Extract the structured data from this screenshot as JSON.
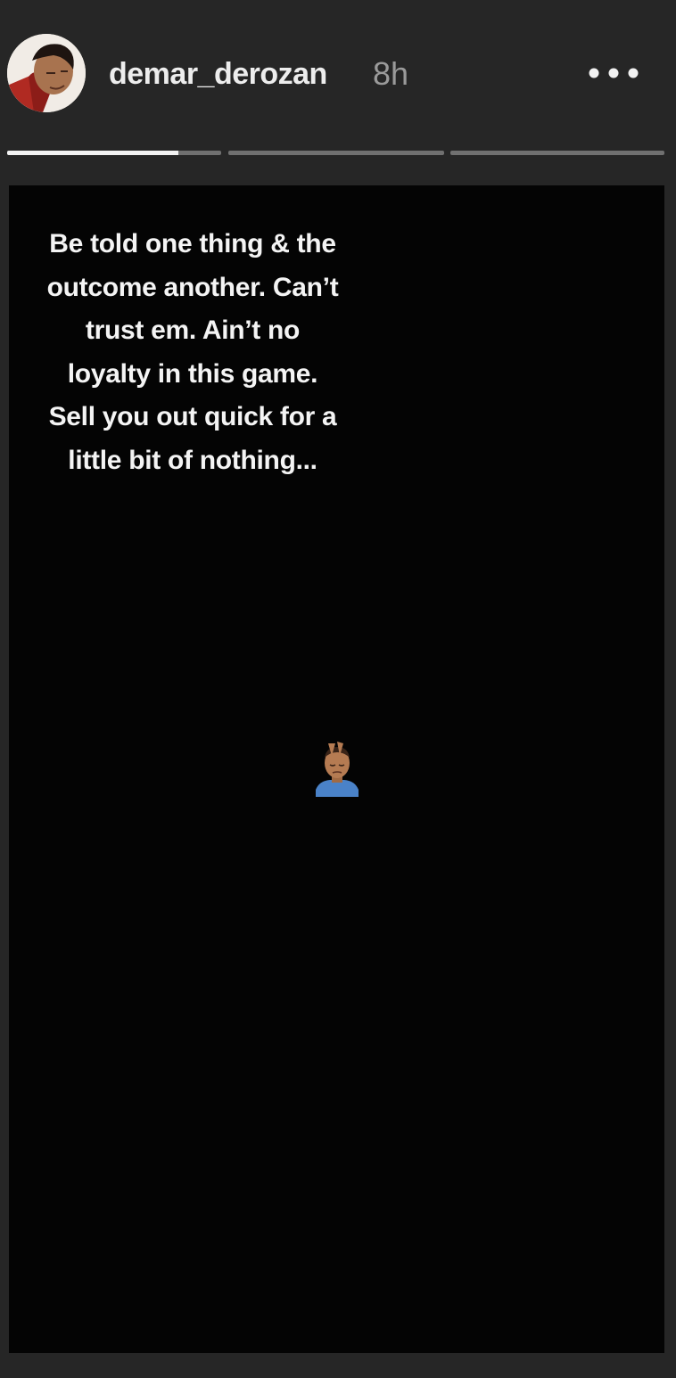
{
  "header": {
    "username": "demar_derozan",
    "time": "8h",
    "avatar_icon": "profile-avatar",
    "more_icon": "more-options-icon"
  },
  "progress": {
    "segments": [
      {
        "fill": 0.8
      },
      {
        "fill": 0
      },
      {
        "fill": 0
      }
    ]
  },
  "story": {
    "caption": "Be told one thing & the\noutcome another. Can’t\ntrust em. Ain’t no\nloyalty in this game.\nSell you out quick for a\nlittle bit of nothing...",
    "emoji_icon": "person-facepalming-emoji-icon"
  },
  "colors": {
    "background": "#262626",
    "story_background": "#040404",
    "text": "#f4f4f4",
    "timestamp": "#9a9a9a",
    "progress_active": "#f2f2f2",
    "progress_inactive": "#707070"
  }
}
